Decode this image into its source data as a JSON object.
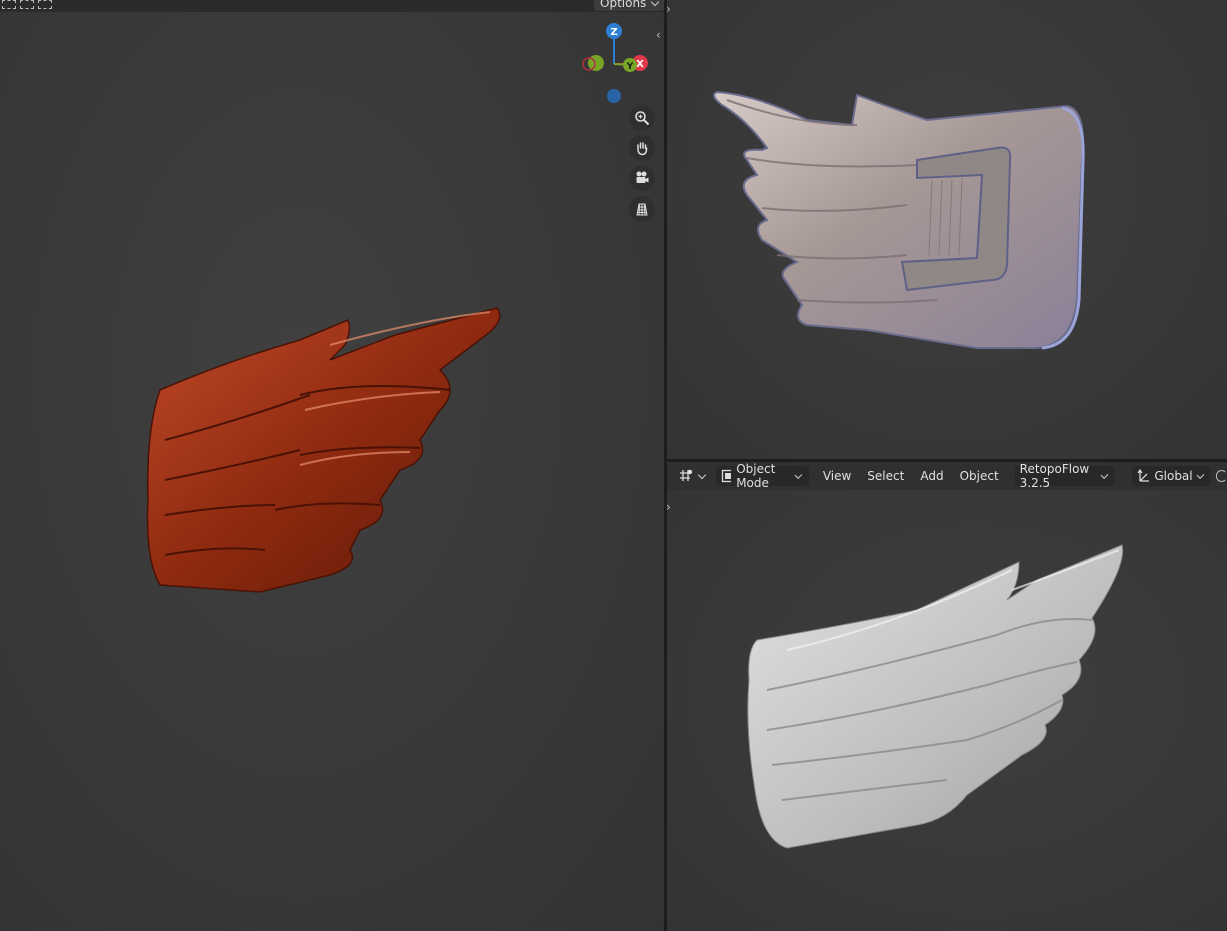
{
  "top_strip": {
    "options_label": "Options"
  },
  "header": {
    "editor_type_icon": "grid-icon",
    "mode_label": "Object Mode",
    "menus": [
      "View",
      "Select",
      "Add",
      "Object"
    ],
    "addon_label": "RetopoFlow 3.2.5",
    "orientation_label": "Global"
  },
  "gizmo": {
    "z_label": "Z",
    "x_label": "X",
    "y_label": "Y",
    "colors": {
      "x": "#e13a4c",
      "y": "#78a626",
      "z": "#2d7fd4"
    }
  },
  "viewport_tools": [
    "zoom-icon",
    "hand-icon",
    "camera-icon",
    "grid-view-icon"
  ],
  "models": {
    "left": {
      "material_color": "#a32f12"
    },
    "top_right": {
      "material_color": "#b8aba8"
    },
    "bottom_right": {
      "material_color": "#c8c8c8"
    }
  }
}
